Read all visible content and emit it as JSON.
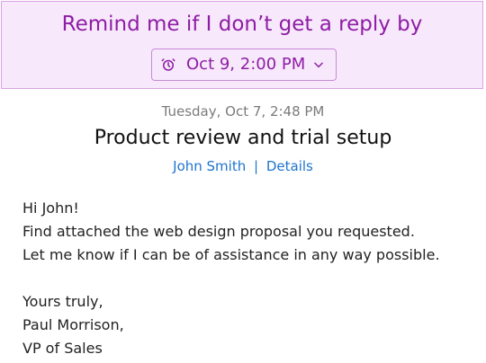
{
  "reminder": {
    "title": "Remind me if I don’t get a reply by",
    "picker_value": "Oct 9, 2:00 PM",
    "icon": "alarm-clock-icon",
    "dropdown_icon": "chevron-down-icon"
  },
  "email": {
    "sent_date": "Tuesday, Oct 7, 2:48 PM",
    "subject": "Product review and trial setup",
    "sender_name": "John Smith",
    "separator": "|",
    "details_link": "Details",
    "body_lines": [
      "Hi John!",
      "Find attached the web design proposal you requested.",
      "Let me know if I can be of assistance in any way possible.",
      "",
      "Yours truly,",
      "Paul Morrison,",
      "VP of Sales"
    ]
  },
  "colors": {
    "reminder_background": "#f8e8fb",
    "reminder_accent": "#8d1ea5",
    "link_blue": "#1e74cf",
    "muted_text": "#7b7b7b"
  }
}
